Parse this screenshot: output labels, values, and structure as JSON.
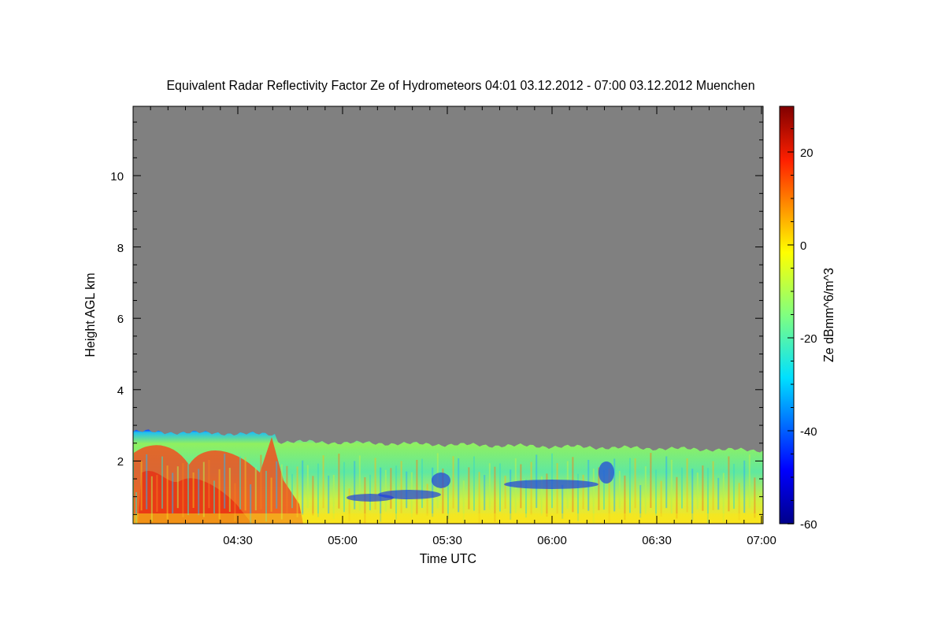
{
  "title": "Equivalent Radar Reflectivity Factor Ze of Hydrometeors   04:01 03.12.2012 - 07:00 03.12.2012 Muenchen",
  "y_axis": {
    "label": "Height AGL km",
    "ticks": [
      "10",
      "8",
      "6",
      "4",
      "2"
    ]
  },
  "x_axis": {
    "label": "Time UTC",
    "ticks": [
      "04:30",
      "05:00",
      "05:30",
      "06:00",
      "06:30",
      "07:00"
    ]
  },
  "colorbar": {
    "label": "Ze dBmm^6/m^3",
    "ticks": [
      "20",
      "0",
      "-20",
      "-40",
      "-60"
    ]
  }
}
